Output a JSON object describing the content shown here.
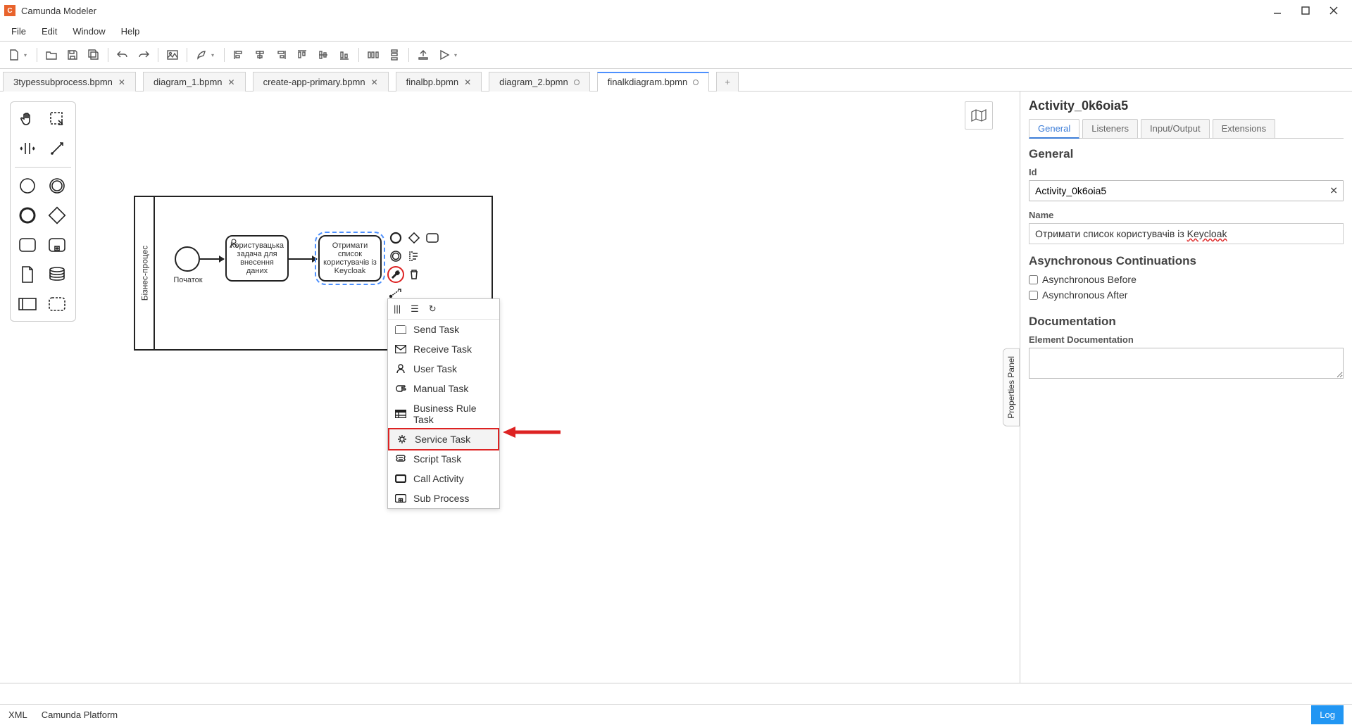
{
  "app": {
    "title": "Camunda Modeler"
  },
  "menu": {
    "items": [
      "File",
      "Edit",
      "Window",
      "Help"
    ]
  },
  "tabs": [
    {
      "label": "3typessubprocess.bpmn",
      "dirty": false,
      "active": false
    },
    {
      "label": "diagram_1.bpmn",
      "dirty": false,
      "active": false
    },
    {
      "label": "create-app-primary.bpmn",
      "dirty": false,
      "active": false
    },
    {
      "label": "finalbp.bpmn",
      "dirty": false,
      "active": false
    },
    {
      "label": "diagram_2.bpmn",
      "dirty": true,
      "active": false
    },
    {
      "label": "finalkdiagram.bpmn",
      "dirty": true,
      "active": true
    }
  ],
  "diagram": {
    "pool_label": "Бізнес-процес",
    "start_label": "Початок",
    "task1": "Користувацька задача для внесення даних",
    "task2": "Отримати список користувачів із Keycloak"
  },
  "replace_menu": {
    "items": [
      "Send Task",
      "Receive Task",
      "User Task",
      "Manual Task",
      "Business Rule Task",
      "Service Task",
      "Script Task",
      "Call Activity",
      "Sub Process"
    ],
    "highlighted_index": 5
  },
  "properties": {
    "title": "Activity_0k6oia5",
    "tabs": [
      "General",
      "Listeners",
      "Input/Output",
      "Extensions"
    ],
    "active_tab": 0,
    "section_general": "General",
    "id_label": "Id",
    "id_value": "Activity_0k6oia5",
    "name_label": "Name",
    "name_value_prefix": "Отримати список користувачів із ",
    "name_value_underlined": "Keycloak",
    "section_async": "Asynchronous Continuations",
    "async_before": "Asynchronous Before",
    "async_after": "Asynchronous After",
    "section_doc": "Documentation",
    "doc_label": "Element Documentation"
  },
  "props_toggle": "Properties Panel",
  "statusbar": {
    "xml": "XML",
    "platform": "Camunda Platform",
    "log": "Log"
  }
}
